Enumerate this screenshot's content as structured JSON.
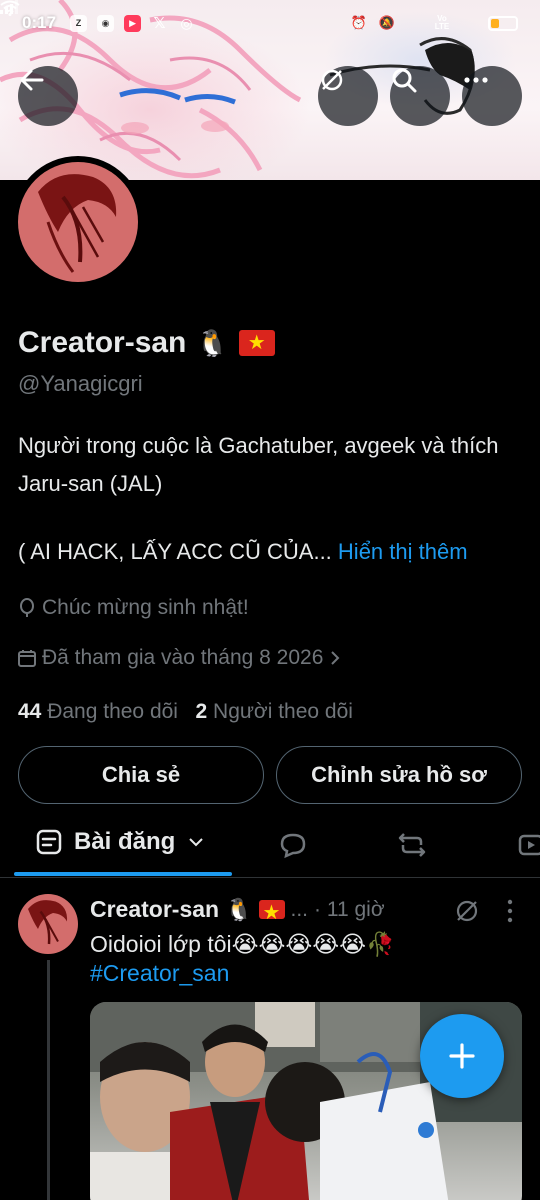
{
  "status_bar": {
    "time": "0:17",
    "apps": [
      "Zalo",
      "Discord",
      "Video",
      "X",
      "Instagram"
    ],
    "network": "Vo LTE",
    "battery_percent": 40
  },
  "header": {
    "back_icon": "arrow-left-icon",
    "hide_icon": "eye-slash-icon",
    "search_icon": "search-icon",
    "more_icon": "more-icon"
  },
  "profile": {
    "display_name": "Creator-san",
    "name_emoji": "🐧",
    "handle": "@Yanagicgri",
    "bio_line1": "Người trong cuộc là Gachatuber, avgeek và thích Jaru-san (JAL)",
    "bio_line2": "( AI HACK, LẤY ACC CŨ CỦA...",
    "show_more": "Hiển thị thêm",
    "birthday": "Chúc mừng sinh nhật!",
    "joined": "Đã tham gia vào tháng 8 2026",
    "following_count": "44",
    "following_label": "Đang theo dõi",
    "followers_count": "2",
    "followers_label": "Người theo dõi"
  },
  "actions": {
    "share": "Chia sẻ",
    "edit_profile": "Chỉnh sửa hồ sơ"
  },
  "tabs": {
    "active_label": "Bài đăng"
  },
  "post": {
    "author": "Creator-san",
    "author_emoji": "🐧",
    "ellipsis": "...",
    "time": "· 11 giờ",
    "text": "Oidoioi lớp tôi😭😭😭😭😭🥀",
    "hashtag": "#Creator_san"
  },
  "colors": {
    "accent": "#1d9bf0",
    "background": "#000000",
    "muted_text": "#71767b",
    "avatar": "#d36d6c"
  }
}
